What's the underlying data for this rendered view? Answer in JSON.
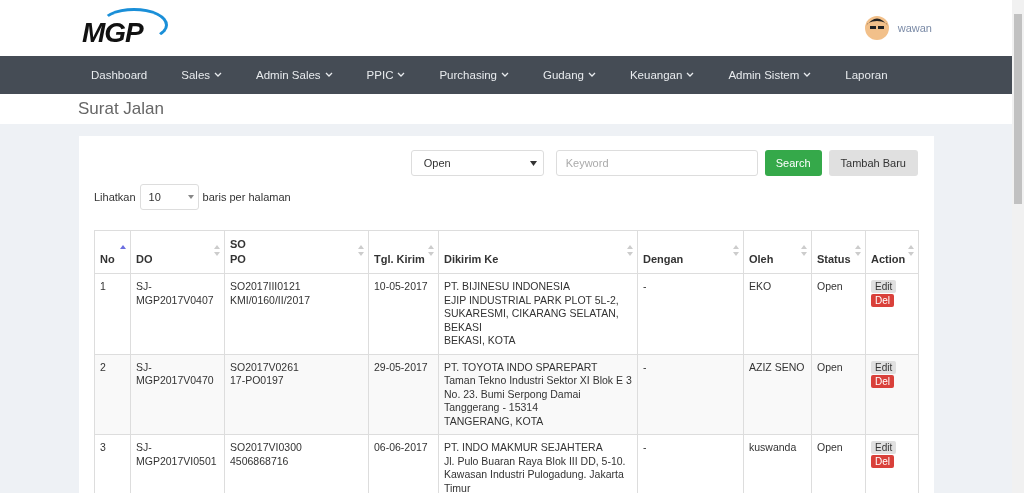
{
  "header": {
    "logo": "MGP",
    "user": "wawan"
  },
  "nav": [
    {
      "label": "Dashboard",
      "dropdown": false
    },
    {
      "label": "Sales",
      "dropdown": true
    },
    {
      "label": "Admin Sales",
      "dropdown": true
    },
    {
      "label": "PPIC",
      "dropdown": true
    },
    {
      "label": "Purchasing",
      "dropdown": true
    },
    {
      "label": "Gudang",
      "dropdown": true
    },
    {
      "label": "Keuangan",
      "dropdown": true
    },
    {
      "label": "Admin Sistem",
      "dropdown": true
    },
    {
      "label": "Laporan",
      "dropdown": false
    }
  ],
  "page_title": "Surat Jalan",
  "filter": {
    "status": "Open",
    "keyword_placeholder": "Keyword",
    "search_button": "Search",
    "add_button": "Tambah Baru"
  },
  "page_size": {
    "label_before": "Lihatkan",
    "value": "10",
    "label_after": "baris per halaman"
  },
  "table": {
    "columns": [
      {
        "label": [
          "No"
        ],
        "sorted": true
      },
      {
        "label": [
          "DO"
        ],
        "sorted": false
      },
      {
        "label": [
          "SO",
          "PO"
        ],
        "sorted": false
      },
      {
        "label": [
          "Tgl. Kirim"
        ],
        "sorted": false
      },
      {
        "label": [
          "Dikirim Ke"
        ],
        "sorted": false
      },
      {
        "label": [
          "Dengan"
        ],
        "sorted": false
      },
      {
        "label": [
          "Oleh"
        ],
        "sorted": false
      },
      {
        "label": [
          "Status"
        ],
        "sorted": false
      },
      {
        "label": [
          "Action"
        ],
        "sorted": false
      }
    ],
    "rows": [
      {
        "no": "1",
        "do": "SJ-MGP2017V0407",
        "so_po": [
          "SO2017III0121",
          "KMI/0160/II/2017"
        ],
        "tgl_kirim": "10-05-2017",
        "dikirim_ke": [
          "PT. BIJINESU INDONESIA",
          "EJIP INDUSTRIAL PARK PLOT 5L-2, SUKARESMI, CIKARANG SELATAN, BEKASI",
          "BEKASI, KOTA"
        ],
        "dengan": "-",
        "oleh": "EKO",
        "status": "Open",
        "actions": [
          "Edit",
          "Del"
        ]
      },
      {
        "no": "2",
        "do": "SJ-MGP2017V0470",
        "so_po": [
          "SO2017V0261",
          "17-PO0197"
        ],
        "tgl_kirim": "29-05-2017",
        "dikirim_ke": [
          "PT. TOYOTA INDO SPAREPART",
          "Taman Tekno Industri Sektor XI Blok E 3 No. 23. Bumi Serpong Damai Tanggerang - 15314",
          "TANGERANG, KOTA"
        ],
        "dengan": "-",
        "oleh": "AZIZ SENO",
        "status": "Open",
        "actions": [
          "Edit",
          "Del"
        ]
      },
      {
        "no": "3",
        "do": "SJ-MGP2017VI0501",
        "so_po": [
          "SO2017VI0300",
          "4506868716"
        ],
        "tgl_kirim": "06-06-2017",
        "dikirim_ke": [
          "PT. INDO MAKMUR SEJAHTERA",
          "Jl. Pulo Buaran Raya Blok III DD, 5-10. Kawasan Industri Pulogadung. Jakarta Timur"
        ],
        "dengan": "-",
        "oleh": "kuswanda",
        "status": "Open",
        "actions": [
          "Edit",
          "Del"
        ]
      }
    ]
  }
}
